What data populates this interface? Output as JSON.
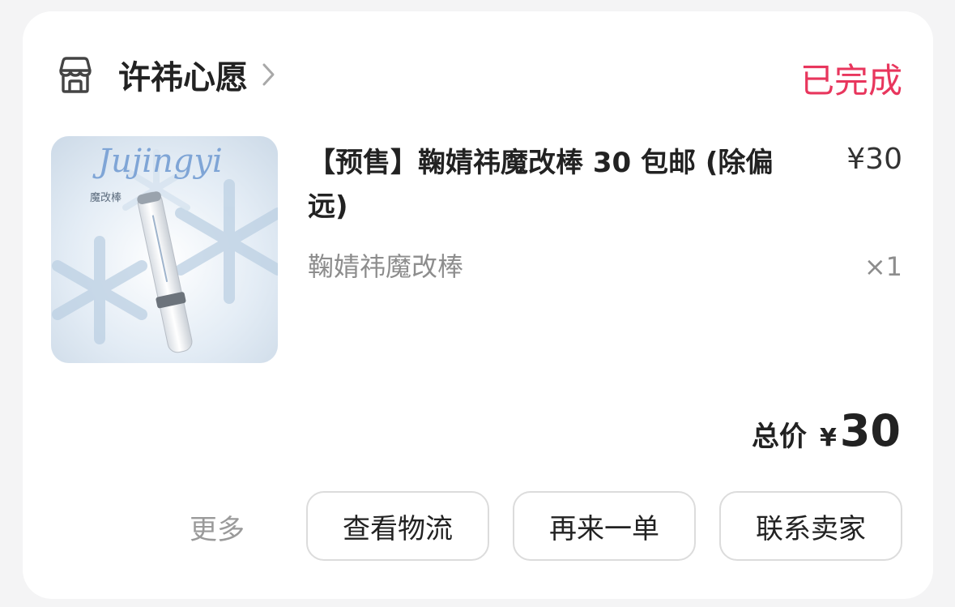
{
  "order": {
    "shop_name": "许祎心愿",
    "status": "已完成",
    "status_color": "#e8365d",
    "product": {
      "title": "【预售】鞠婧祎魔改棒 30 包邮 (除偏远)",
      "price": "¥30",
      "spec": "鞠婧祎魔改棒",
      "quantity": "×1",
      "image_text": {
        "brand": "Jujingyi",
        "label": "魔改棒"
      }
    },
    "total": {
      "label": "总价",
      "currency": "¥",
      "value": "30"
    },
    "actions": {
      "more": "更多",
      "logistics": "查看物流",
      "reorder": "再来一单",
      "contact": "联系卖家"
    }
  },
  "icons": {
    "shop": "shop-icon",
    "chevron": "chevron-right-icon"
  }
}
